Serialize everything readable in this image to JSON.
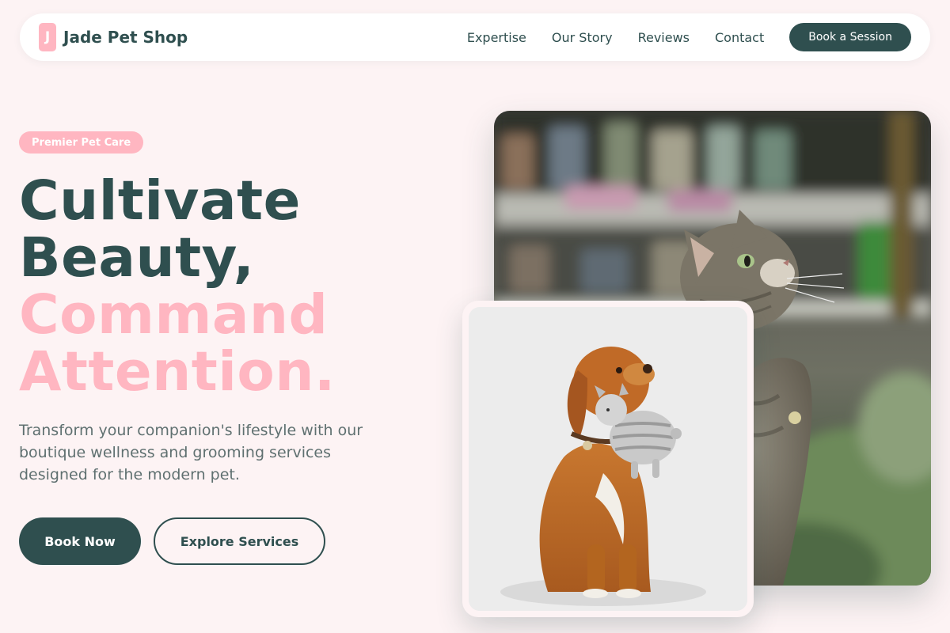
{
  "brand": {
    "logo_letter": "J",
    "name": "Jade Pet Shop"
  },
  "nav": {
    "links": [
      "Expertise",
      "Our Story",
      "Reviews",
      "Contact"
    ],
    "cta": "Book a Session"
  },
  "hero": {
    "badge": "Premier Pet Care",
    "headline_line1": "Cultivate",
    "headline_line2": "Beauty,",
    "headline_line3": "Command",
    "headline_line4": "Attention.",
    "description": "Transform your companion's lifestyle with our boutique wellness and grooming services designed for the modern pet.",
    "primary_button": "Book Now",
    "secondary_button": "Explore Services"
  },
  "images": {
    "main": "cat-in-pet-store-photo",
    "overlay": "dog-with-toy-photo"
  },
  "colors": {
    "primary": "#2f4f4f",
    "accent": "#ffb6c1",
    "background": "#fdf3f4",
    "muted_text": "#5f7070"
  }
}
